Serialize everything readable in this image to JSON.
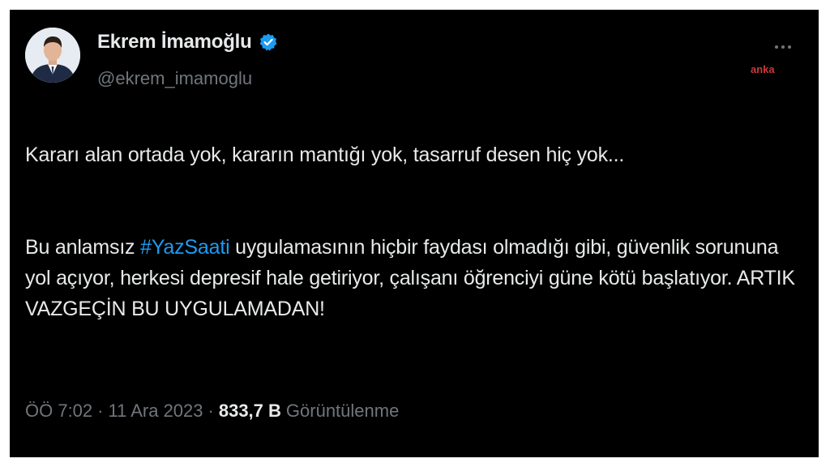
{
  "author": {
    "display_name": "Ekrem İmamoğlu",
    "handle": "@ekrem_imamoglu",
    "verified": true
  },
  "watermark": "anka",
  "tweet": {
    "line1": "Kararı alan ortada yok, kararın mantığı yok, tasarruf desen hiç yok...",
    "p2_before_hashtag": "Bu anlamsız ",
    "hashtag": "#YazSaati",
    "p2_after_hashtag": " uygulamasının hiçbir faydası olmadığı gibi, güvenlik sorununa yol açıyor, herkesi depresif hale getiriyor, çalışanı öğrenciyi güne kötü başlatıyor. ARTIK VAZGEÇİN BU UYGULAMADAN!"
  },
  "meta": {
    "time": "ÖÖ 7:02",
    "separator": "·",
    "date": "11 Ara 2023",
    "views_count": "833,7 B",
    "views_label": "Görüntülenme"
  },
  "colors": {
    "background": "#000000",
    "text": "#e7e9ea",
    "secondary": "#71767b",
    "accent": "#1d9bf0",
    "watermark": "#c83a3a"
  },
  "icons": {
    "verified": "verified-badge-icon",
    "more": "more-options-icon"
  }
}
